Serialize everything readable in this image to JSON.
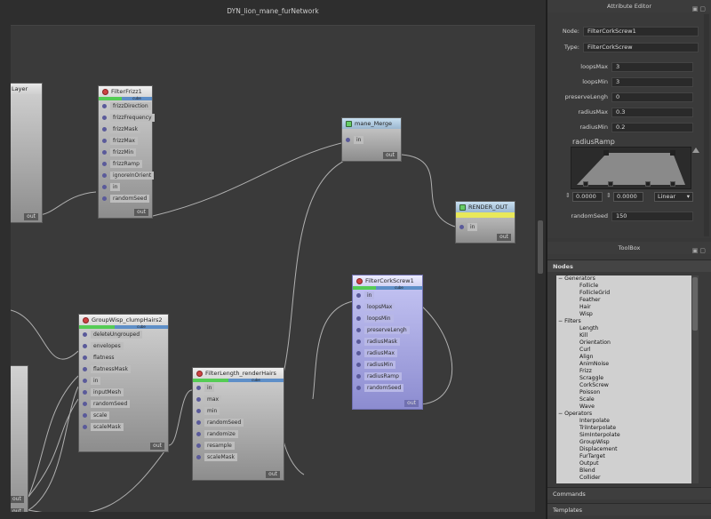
{
  "graph": {
    "title": "DYN_lion_mane_furNetwork",
    "wire_color": "#b0b0b0",
    "nodes": {
      "layer": {
        "title": "Layer",
        "out": "out"
      },
      "filter_frizz": {
        "title": "FilterFrizz1",
        "bar": "cube",
        "ports": [
          "frizzDirection",
          "frizzFrequency",
          "frizzMask",
          "frizzMax",
          "frizzMin",
          "frizzRamp",
          "ignoreInOrient",
          "in",
          "randomSeed"
        ],
        "out": "out"
      },
      "mane_merge": {
        "title": "mane_Merge",
        "ports": [
          "in"
        ],
        "out": "out"
      },
      "render_out": {
        "title": "RENDER_OUT",
        "ports": [
          "in"
        ],
        "out": "out"
      },
      "cork_screw": {
        "title": "FilterCorkScrew1",
        "bar": "cube",
        "ports": [
          "in",
          "loopsMax",
          "loopsMin",
          "preserveLengh",
          "radiusMask",
          "radiusMax",
          "radiusMin",
          "radiusRamp",
          "randomSeed"
        ],
        "out": "out"
      },
      "group_wisp": {
        "title": "GroupWisp_clumpHairs2",
        "bar": "cube",
        "ports": [
          "deleteUngrouped",
          "envelopes",
          "flatness",
          "flatnessMask",
          "in",
          "inputMesh",
          "randomSeed",
          "scale",
          "scaleMask"
        ],
        "out": "out"
      },
      "filter_length": {
        "title": "FilterLength_renderHairs",
        "bar": "cube",
        "ports": [
          "in",
          "max",
          "min",
          "randomSeed",
          "randomize",
          "resample",
          "scaleMask"
        ],
        "out": "out"
      },
      "left_stub": {
        "out_a": "out",
        "out_b": "out"
      }
    }
  },
  "attribute_editor": {
    "title": "Attribute Editor",
    "node_label": "Node:",
    "node_value": "FilterCorkScrew1",
    "type_label": "Type:",
    "type_value": "FilterCorkScrew",
    "fields": [
      {
        "label": "loopsMax",
        "value": "3"
      },
      {
        "label": "loopsMin",
        "value": "3"
      },
      {
        "label": "preserveLengh",
        "value": "0"
      },
      {
        "label": "radiusMax",
        "value": "0.3"
      },
      {
        "label": "radiusMin",
        "value": "0.2"
      }
    ],
    "ramp": {
      "title": "radiusRamp",
      "pos": "0.0000",
      "val": "0.0000",
      "interp": "Linear"
    },
    "random_seed_label": "randomSeed",
    "random_seed_value": "150"
  },
  "toolbox": {
    "title": "ToolBox",
    "nodes_tab": "Nodes",
    "tree": [
      {
        "group": "Generators",
        "items": [
          "Follicle",
          "FollicleGrid",
          "Feather",
          "Hair",
          "Wisp"
        ]
      },
      {
        "group": "Filters",
        "items": [
          "Length",
          "Kill",
          "Orientation",
          "Curl",
          "Align",
          "AnimNoise",
          "Frizz",
          "Scraggle",
          "CorkScrew",
          "Poisson",
          "Scale",
          "Wave"
        ]
      },
      {
        "group": "Operators",
        "items": [
          "Interpolate",
          "TriInterpolate",
          "SimInterpolate",
          "GroupWisp",
          "Displacement",
          "FurTarget",
          "Output",
          "Blend",
          "Collider"
        ]
      }
    ],
    "commands_tab": "Commands",
    "templates_tab": "Templates"
  },
  "colors": {
    "cube_bar": "#55cc55",
    "selected_node": "#a4a4e4",
    "render_out_band": "#e8e85a"
  }
}
